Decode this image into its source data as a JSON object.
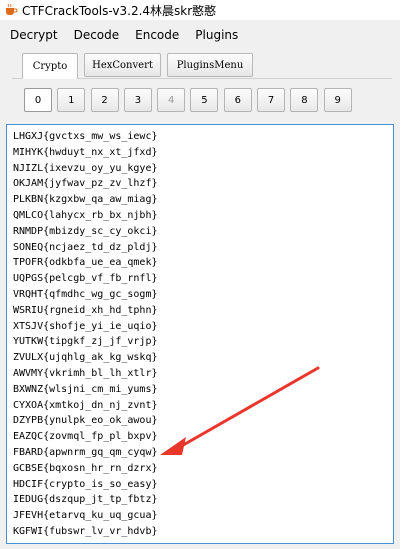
{
  "window": {
    "title": "CTFCrackTools-v3.2.4林晨skr憨憨"
  },
  "menu": [
    "Decrypt",
    "Decode",
    "Encode",
    "Plugins"
  ],
  "tabs": [
    {
      "label": "Crypto",
      "active": true
    },
    {
      "label": "HexConvert",
      "active": false
    },
    {
      "label": "PluginsMenu",
      "active": false
    }
  ],
  "number_buttons": [
    {
      "label": "0",
      "state": "active"
    },
    {
      "label": "1",
      "state": "normal"
    },
    {
      "label": "2",
      "state": "normal"
    },
    {
      "label": "3",
      "state": "normal"
    },
    {
      "label": "4",
      "state": "disabled"
    },
    {
      "label": "5",
      "state": "normal"
    },
    {
      "label": "6",
      "state": "normal"
    },
    {
      "label": "7",
      "state": "normal"
    },
    {
      "label": "8",
      "state": "normal"
    },
    {
      "label": "9",
      "state": "normal"
    }
  ],
  "output_lines": [
    "LHGXJ{gvctxs_mw_ws_iewc}",
    "MIHYK{hwduyt_nx_xt_jfxd}",
    "NJIZL{ixevzu_oy_yu_kgye}",
    "OKJAM{jyfwav_pz_zv_lhzf}",
    "PLKBN{kzgxbw_qa_aw_miag}",
    "QMLCO{lahycx_rb_bx_njbh}",
    "RNMDP{mbizdy_sc_cy_okci}",
    "SONEQ{ncjaez_td_dz_pldj}",
    "TPOFR{odkbfa_ue_ea_qmek}",
    "UQPGS{pelcgb_vf_fb_rnfl}",
    "VRQHT{qfmdhc_wg_gc_sogm}",
    "WSRIU{rgneid_xh_hd_tphn}",
    "XTSJV{shofje_yi_ie_uqio}",
    "YUTKW{tipgkf_zj_jf_vrjp}",
    "ZVULX{ujqhlg_ak_kg_wskq}",
    "AWVMY{vkrimh_bl_lh_xtlr}",
    "BXWNZ{wlsjni_cm_mi_yums}",
    "CYXOA{xmtkoj_dn_nj_zvnt}",
    "DZYPB{ynulpk_eo_ok_awou}",
    "EAZQC{zovmql_fp_pl_bxpv}",
    "FBARD{apwnrm_gq_qm_cyqw}",
    "GCBSE{bqxosn_hr_rn_dzrx}",
    "HDCIF{crypto_is_so_easy}",
    "IEDUG{dszqup_jt_tp_fbtz}",
    "JFEVH{etarvq_ku_uq_gcua}",
    "KGFWI{fubswr_lv_vr_hdvb}"
  ],
  "colors": {
    "accent": "#4a8fd8",
    "annotation": "#e8362b"
  }
}
